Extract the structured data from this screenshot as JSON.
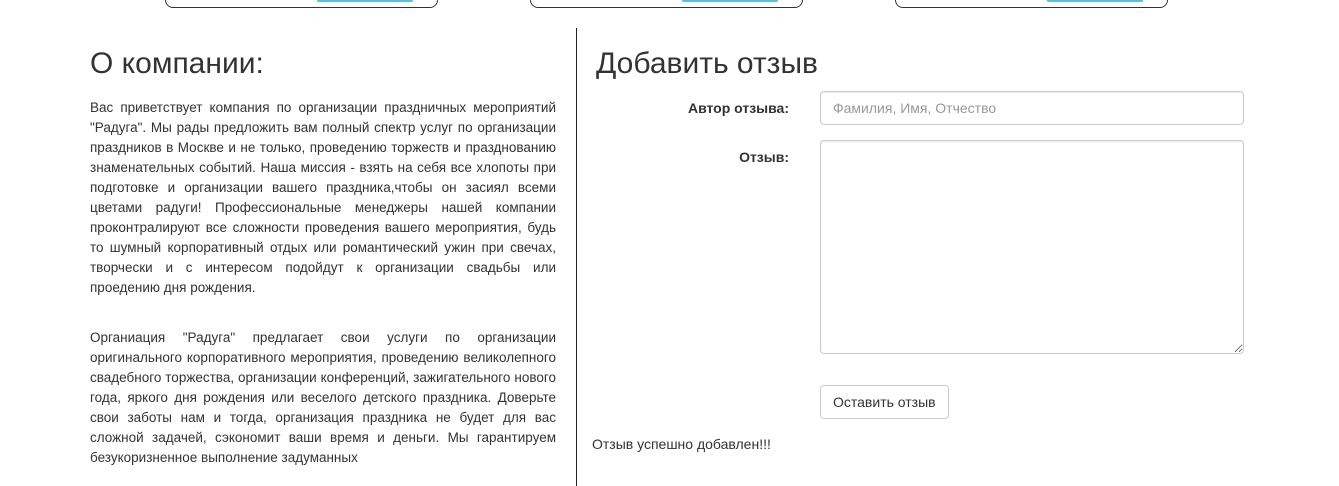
{
  "about": {
    "title": "О компании:",
    "paragraphs": [
      "Вас приветствует компания по организации праздничных мероприятий \"Радуга\". Мы рады предложить вам полный спектр услуг по организации праздников в Москве и не только, проведению торжеств и празднованию знаменательных событий. Наша миссия - взять на себя все хлопоты при подготовке и организации вашего праздника,чтобы он засиял всеми цветами радуги! Профессиональные менеджеры нашей компании проконтралируют все сложности проведения вашего мероприятия, будь то шумный корпоративный отдых или романтический ужин при свечах, творчески и с интересом подойдут к организации свадьбы или проедению дня рождения.",
      "Органиация \"Радуга\" предлагает свои услуги по организации оригинального корпоративного мероприятия, проведению великолепного свадебного торжества, организации конференций, зажигательного нового года, яркого дня рождения или веселого детского праздника. Доверьте свои заботы нам и тогда, организация праздника не будет для вас сложной задачей, сэкономит ваши время и деньги. Мы гарантируем безукоризненное выполнение задуманных"
    ]
  },
  "review_form": {
    "title": "Добавить отзыв",
    "author_label": "Автор отзыва:",
    "author_placeholder": "Фамилия, Имя, Отчество",
    "author_value": "",
    "review_label": "Отзыв:",
    "review_value": "",
    "submit_label": "Оставить отзыв",
    "success_message": "Отзыв успешно добавлен!!!"
  },
  "colors": {
    "text": "#333333",
    "input_border": "#cccccc",
    "placeholder": "#999999",
    "accent_strip": "#5bc0de",
    "divider": "#222222"
  }
}
